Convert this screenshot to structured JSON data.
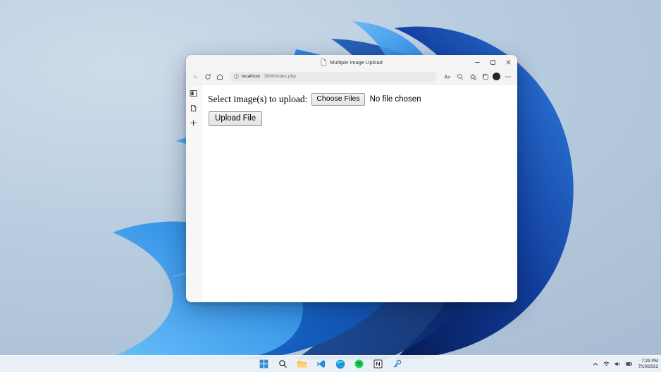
{
  "desktop": {
    "wallpaper_name": "windows-11-bloom-wallpaper",
    "colors": {
      "bg_light": "#cfdcea",
      "bg_mid": "#b9cde0",
      "bg_dark": "#a8bdd3",
      "petal_light": "#3aa0f2",
      "petal_mid": "#1f7ae0",
      "petal_deep": "#0d3fa8",
      "petal_darkest": "#061a52"
    }
  },
  "browser": {
    "titlebar": {
      "tab_title": "Multiple Image Upload",
      "tab_icon": "page-icon",
      "window_controls": [
        {
          "name": "minimize-button",
          "glyph": "minimize-icon"
        },
        {
          "name": "maximize-button",
          "glyph": "maximize-icon"
        },
        {
          "name": "close-button",
          "glyph": "close-icon"
        }
      ]
    },
    "toolbar": {
      "back_icon": "back-arrow-icon",
      "refresh_icon": "refresh-icon",
      "home_icon": "home-icon",
      "address": {
        "info_icon": "info-circle-icon",
        "host": "localhost",
        "path": ":3000/index.php",
        "full_url": "localhost:3000/index.php"
      },
      "right_icons": [
        {
          "name": "read-aloud-icon"
        },
        {
          "name": "zoom-icon"
        },
        {
          "name": "favorites-icon"
        },
        {
          "name": "collections-icon"
        },
        {
          "name": "profile-avatar"
        },
        {
          "name": "settings-more-icon"
        }
      ]
    },
    "edgebar": [
      {
        "name": "split-screen-icon"
      },
      {
        "name": "copilot-page-icon"
      },
      {
        "name": "add-tool-icon",
        "glyph": "+"
      }
    ],
    "page": {
      "label": "Select image(s) to upload:",
      "choose_files_button": "Choose Files",
      "no_file_text": "No file chosen",
      "upload_button": "Upload File"
    }
  },
  "taskbar": {
    "icons": [
      {
        "name": "start-button",
        "label": "Start"
      },
      {
        "name": "search-button",
        "label": "Search"
      },
      {
        "name": "file-explorer-button",
        "label": "File Explorer"
      },
      {
        "name": "vscode-button",
        "label": "Visual Studio Code"
      },
      {
        "name": "edge-button",
        "label": "Microsoft Edge"
      },
      {
        "name": "spotify-button",
        "label": "Spotify"
      },
      {
        "name": "notion-button",
        "label": "Notion"
      },
      {
        "name": "key-app-button",
        "label": "Key"
      }
    ],
    "tray": {
      "chevron_icon": "chevron-up-icon",
      "network_icon": "wifi-icon",
      "volume_icon": "volume-icon",
      "battery_icon": "battery-icon",
      "time": "7:29 PM",
      "date": "7/10/2022"
    }
  }
}
